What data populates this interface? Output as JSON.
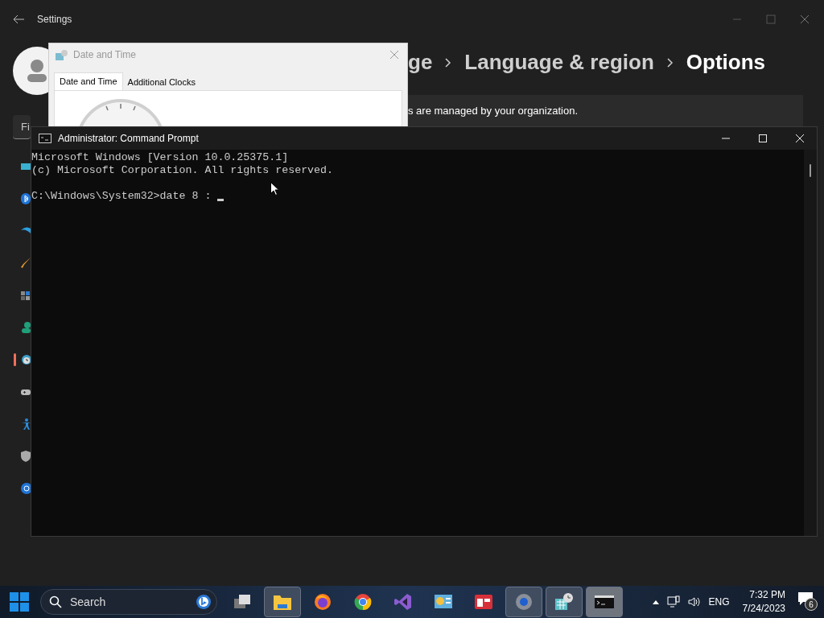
{
  "settings": {
    "title": "Settings",
    "breadcrumb": [
      {
        "label": "ge",
        "current": false
      },
      {
        "label": "Language & region",
        "current": false
      },
      {
        "label": "Options",
        "current": true
      }
    ],
    "notice": "s are managed by your organization.",
    "search": {
      "placeholder": "Fi"
    },
    "nav_items": [
      {
        "kind": "display",
        "selected": false
      },
      {
        "kind": "bluetooth",
        "selected": false
      },
      {
        "kind": "network",
        "selected": false
      },
      {
        "kind": "brush",
        "selected": false
      },
      {
        "kind": "apps",
        "selected": false
      },
      {
        "kind": "accounts",
        "selected": false
      },
      {
        "kind": "time",
        "selected": true
      },
      {
        "kind": "gaming",
        "selected": false
      },
      {
        "kind": "accessibility",
        "selected": false
      },
      {
        "kind": "privacy",
        "selected": false
      },
      {
        "kind": "update",
        "selected": false
      }
    ]
  },
  "dialog": {
    "title": "Date and Time",
    "tabs": [
      {
        "label": "Date and Time",
        "selected": true
      },
      {
        "label": "Additional Clocks",
        "selected": false
      }
    ]
  },
  "console": {
    "title": "Administrator: Command Prompt",
    "output": [
      "Microsoft Windows [Version 10.0.25375.1]",
      "(c) Microsoft Corporation. All rights reserved."
    ],
    "prompt": "C:\\Windows\\System32>date 8 : "
  },
  "taskbar": {
    "search": {
      "placeholder": "Search"
    },
    "apps": [
      {
        "kind": "task-view",
        "running": false,
        "focused": false
      },
      {
        "kind": "folder",
        "running": true,
        "focused": false
      },
      {
        "kind": "firefox",
        "running": false,
        "focused": false
      },
      {
        "kind": "chrome",
        "running": false,
        "focused": false
      },
      {
        "kind": "visual-studio",
        "running": false,
        "focused": false
      },
      {
        "kind": "control-panel",
        "running": false,
        "focused": false
      },
      {
        "kind": "news",
        "running": false,
        "focused": false
      },
      {
        "kind": "settings",
        "running": true,
        "focused": false
      },
      {
        "kind": "date-time",
        "running": true,
        "focused": false
      },
      {
        "kind": "terminal",
        "running": true,
        "focused": true
      }
    ],
    "tray": {
      "language": "ENG",
      "time": "7:32 PM",
      "date": "7/24/2023",
      "notifications": "6"
    }
  }
}
